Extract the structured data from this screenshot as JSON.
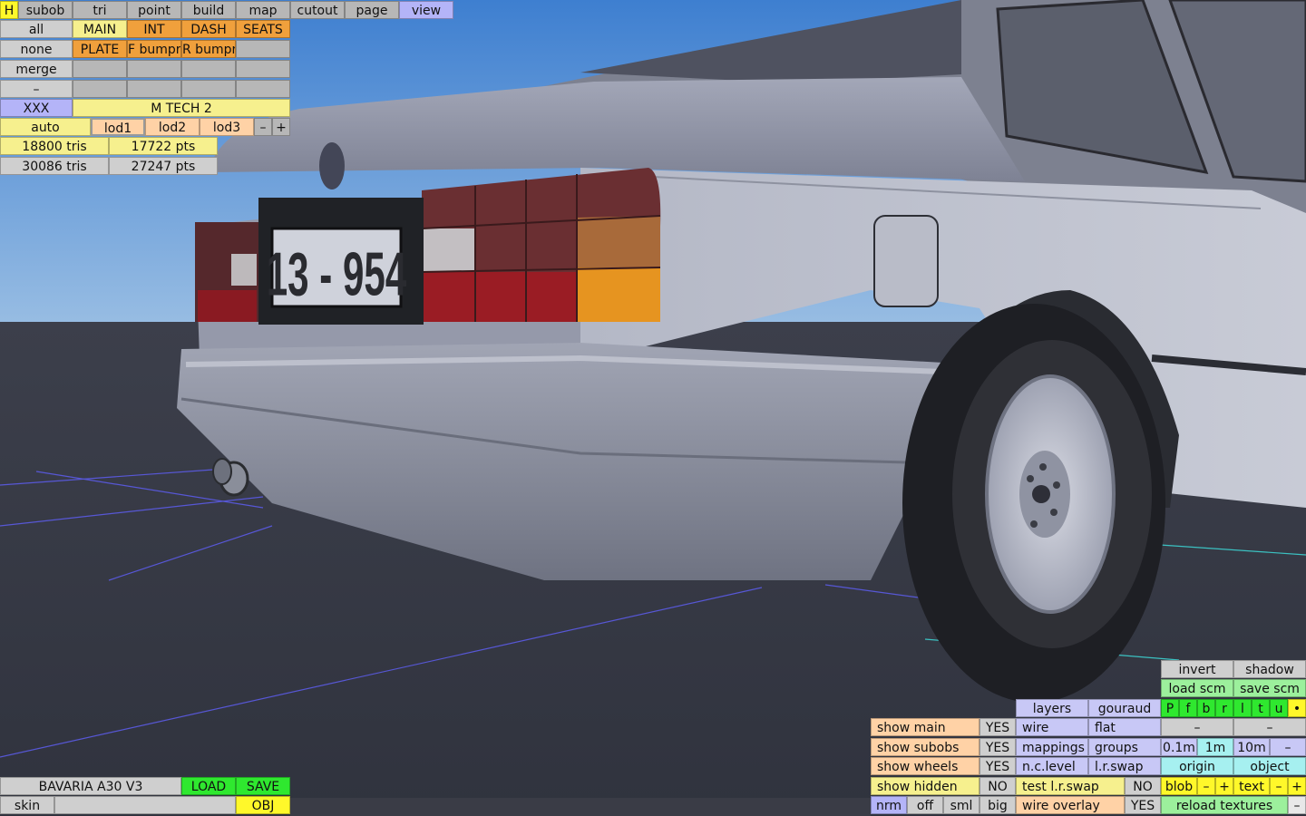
{
  "toolbar": {
    "tabs": [
      "H",
      "subob",
      "tri",
      "point",
      "build",
      "map",
      "cutout",
      "page",
      "view"
    ]
  },
  "left_panel": {
    "row_all": {
      "label": "all",
      "items": [
        "MAIN",
        "INT",
        "DASH",
        "SEATS"
      ]
    },
    "row_none": {
      "label": "none",
      "items": [
        "PLATE",
        "F bumpr",
        "R bumpr"
      ]
    },
    "row_merge": {
      "label": "merge"
    },
    "row_minus": {
      "label": "–"
    },
    "row_xxx": {
      "label": "XXX",
      "name": "M TECH 2"
    },
    "lod": {
      "auto": "auto",
      "lod1": "lod1",
      "lod2": "lod2",
      "lod3": "lod3",
      "minus": "–",
      "plus": "+"
    },
    "stats": {
      "tris_a": "18800 tris",
      "pts_a": "17722 pts",
      "tris_b": "30086 tris",
      "pts_b": "27247 pts"
    }
  },
  "bottom_left": {
    "model_name": "BAVARIA A30 V3",
    "load": "LOAD",
    "save": "SAVE",
    "skin": "skin",
    "obj": "OBJ"
  },
  "bottom_right": {
    "invert": "invert",
    "shadow": "shadow",
    "load_scm": "load scm",
    "save_scm": "save scm",
    "layers": "layers",
    "gouraud": "gouraud",
    "letters": [
      "P",
      "f",
      "b",
      "r",
      "l",
      "t",
      "u",
      "•"
    ],
    "show_main": "show main",
    "show_main_val": "YES",
    "wire": "wire",
    "flat": "flat",
    "dash1": "–",
    "dash2": "–",
    "show_subobs": "show subobs",
    "show_subobs_val": "YES",
    "mappings": "mappings",
    "groups": "groups",
    "m01": "0.1m",
    "m1": "1m",
    "m10": "10m",
    "mdash": "–",
    "show_wheels": "show wheels",
    "show_wheels_val": "YES",
    "nclevel": "n.c.level",
    "lrswap": "l.r.swap",
    "origin": "origin",
    "object": "object",
    "show_hidden": "show hidden",
    "show_hidden_val": "NO",
    "test_lrswap": "test l.r.swap",
    "test_lrswap_val": "NO",
    "blob": "blob",
    "blob_minus": "–",
    "blob_plus": "+",
    "text": "text",
    "text_minus": "–",
    "text_plus": "+",
    "nrm": "nrm",
    "off": "off",
    "sml": "sml",
    "big": "big",
    "wire_overlay": "wire overlay",
    "wire_overlay_val": "YES",
    "reload": "reload textures",
    "reload_dash": "–"
  },
  "scene": {
    "plate_text": "13 - 954"
  }
}
